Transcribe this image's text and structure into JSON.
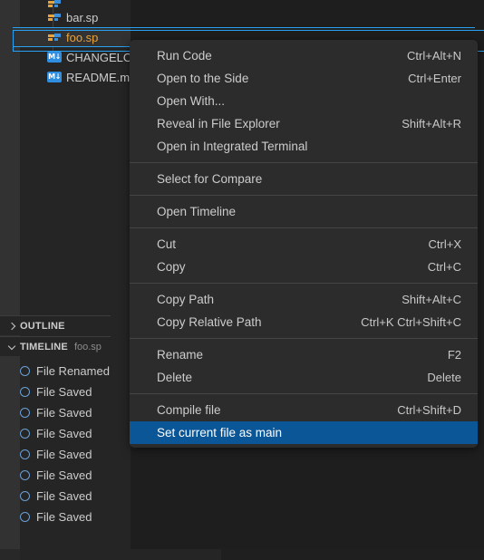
{
  "sidebar": {
    "tree": [
      {
        "name": "",
        "icon": "sp-file-icon",
        "partial": true,
        "selected": false
      },
      {
        "name": "bar.sp",
        "icon": "sp-file-icon",
        "partial": false,
        "selected": false
      },
      {
        "name": "foo.sp",
        "icon": "sp-file-icon",
        "partial": false,
        "selected": true
      },
      {
        "name": "CHANGELOG.md",
        "icon": "markdown-icon",
        "icon_text": "M↓",
        "partial": false,
        "selected": false
      },
      {
        "name": "README.md",
        "icon": "markdown-icon",
        "icon_text": "M↓",
        "partial": false,
        "selected": false
      }
    ],
    "outline": {
      "title": "OUTLINE",
      "expanded": false
    },
    "timeline": {
      "title": "TIMELINE",
      "subtitle": "foo.sp",
      "expanded": true,
      "items": [
        {
          "label": "File Renamed"
        },
        {
          "label": "File Saved"
        },
        {
          "label": "File Saved"
        },
        {
          "label": "File Saved"
        },
        {
          "label": "File Saved"
        },
        {
          "label": "File Saved"
        },
        {
          "label": "File Saved"
        },
        {
          "label": "File Saved"
        }
      ]
    }
  },
  "context_menu": {
    "highlight_color": "#0b5697",
    "groups": [
      {
        "items": [
          {
            "label": "Run Code",
            "key": "Ctrl+Alt+N",
            "highlighted": false
          },
          {
            "label": "Open to the Side",
            "key": "Ctrl+Enter",
            "highlighted": false
          },
          {
            "label": "Open With...",
            "key": "",
            "highlighted": false
          },
          {
            "label": "Reveal in File Explorer",
            "key": "Shift+Alt+R",
            "highlighted": false
          },
          {
            "label": "Open in Integrated Terminal",
            "key": "",
            "highlighted": false
          }
        ]
      },
      {
        "items": [
          {
            "label": "Select for Compare",
            "key": "",
            "highlighted": false
          }
        ]
      },
      {
        "items": [
          {
            "label": "Open Timeline",
            "key": "",
            "highlighted": false
          }
        ]
      },
      {
        "items": [
          {
            "label": "Cut",
            "key": "Ctrl+X",
            "highlighted": false
          },
          {
            "label": "Copy",
            "key": "Ctrl+C",
            "highlighted": false
          }
        ]
      },
      {
        "items": [
          {
            "label": "Copy Path",
            "key": "Shift+Alt+C",
            "highlighted": false
          },
          {
            "label": "Copy Relative Path",
            "key": "Ctrl+K Ctrl+Shift+C",
            "highlighted": false
          }
        ]
      },
      {
        "items": [
          {
            "label": "Rename",
            "key": "F2",
            "highlighted": false
          },
          {
            "label": "Delete",
            "key": "Delete",
            "highlighted": false
          }
        ]
      },
      {
        "items": [
          {
            "label": "Compile file",
            "key": "Ctrl+Shift+D",
            "highlighted": false
          },
          {
            "label": "Set current file as main",
            "key": "",
            "highlighted": true
          }
        ]
      }
    ]
  }
}
